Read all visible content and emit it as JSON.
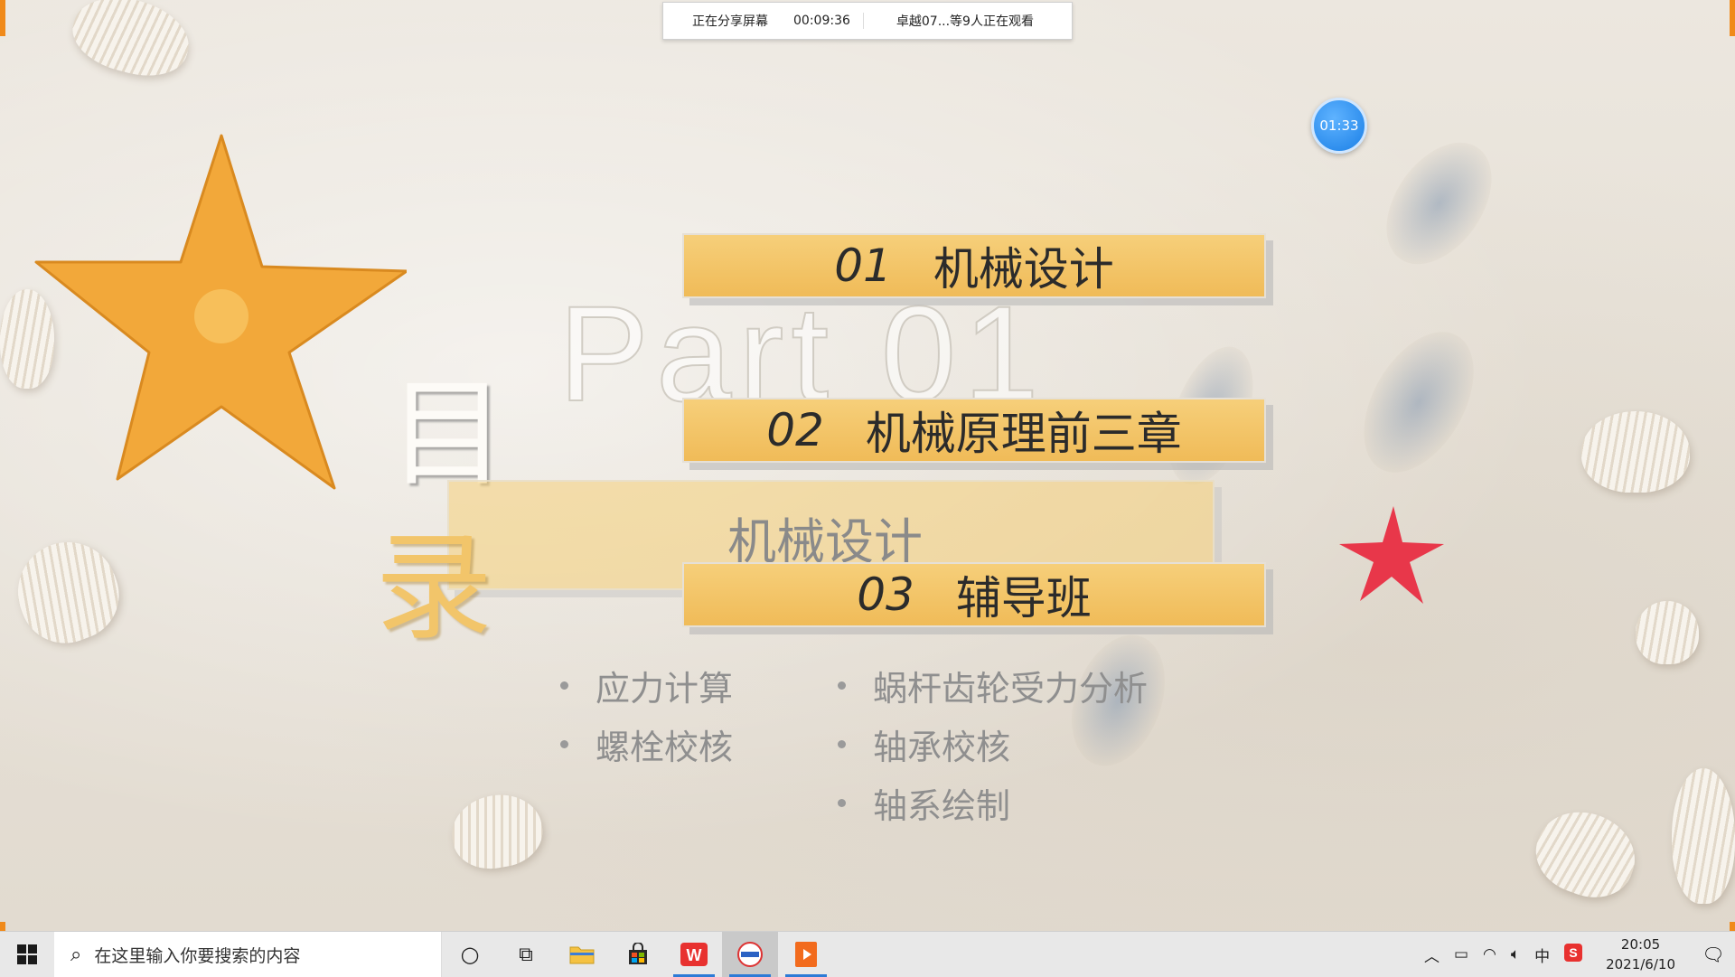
{
  "share_bar": {
    "status": "正在分享屏幕",
    "elapsed": "00:09:36",
    "viewers": "卓越07...等9人正在观看"
  },
  "timer_badge": "01:33",
  "slide": {
    "heading_top": "目",
    "heading_bottom": "录",
    "part_label": "Part  01",
    "overlay_title": "机械设计",
    "menu": [
      {
        "num": "01",
        "label": "机械设计"
      },
      {
        "num": "02",
        "label": "机械原理前三章"
      },
      {
        "num": "03",
        "label": "辅导班"
      }
    ],
    "bullets_left": [
      "应力计算",
      "螺栓校核"
    ],
    "bullets_right": [
      "蜗杆齿轮受力分析",
      "轴承校核",
      "轴系绘制"
    ]
  },
  "taskbar": {
    "search_placeholder": "在这里输入你要搜索的内容",
    "apps": [
      {
        "name": "cortana-icon",
        "glyph": "○"
      },
      {
        "name": "task-view-icon",
        "glyph": "⧉"
      },
      {
        "name": "file-explorer-icon",
        "glyph": "📁"
      },
      {
        "name": "store-icon",
        "glyph": "🛍"
      },
      {
        "name": "wps-icon",
        "glyph": "W"
      },
      {
        "name": "meeting-app-icon",
        "glyph": "◉"
      },
      {
        "name": "presentation-icon",
        "glyph": "▶"
      }
    ],
    "tray": {
      "ime": "中",
      "time": "20:05",
      "date": "2021/6/10"
    }
  },
  "colors": {
    "accent_yellow": "#f0bb58",
    "badge_blue": "#1a7fe6",
    "edge_orange": "#f08a1a"
  }
}
